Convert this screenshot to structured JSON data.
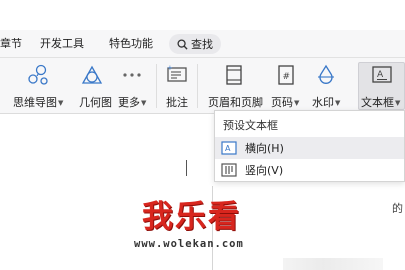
{
  "menubar": {
    "items": [
      {
        "label": "章节"
      },
      {
        "label": "开发工具"
      },
      {
        "label": "特色功能"
      }
    ],
    "search_label": "查找"
  },
  "ribbon": {
    "tools": [
      {
        "label": "思维导图",
        "icon": "mindmap-icon",
        "has_dropdown": true
      },
      {
        "label": "几何图",
        "icon": "geometry-icon",
        "has_dropdown": false
      },
      {
        "label": "更多",
        "icon": "more-dots-icon",
        "has_dropdown": true
      },
      {
        "label": "批注",
        "icon": "comment-icon",
        "has_dropdown": false
      },
      {
        "label": "页眉和页脚",
        "icon": "header-footer-icon",
        "has_dropdown": false
      },
      {
        "label": "页码",
        "icon": "page-number-icon",
        "has_dropdown": true
      },
      {
        "label": "水印",
        "icon": "watermark-icon",
        "has_dropdown": true
      },
      {
        "label": "文本框",
        "icon": "textbox-icon",
        "has_dropdown": true
      }
    ]
  },
  "dropdown": {
    "header": "预设文本框",
    "items": [
      {
        "label": "横向(H)",
        "icon": "horizontal-textbox-icon",
        "highlighted": true
      },
      {
        "label": "竖向(V)",
        "icon": "vertical-textbox-icon",
        "highlighted": false
      }
    ]
  },
  "watermark": {
    "title": "我乐看",
    "url": "www.wolekan.com"
  },
  "edge_text": "的",
  "colors": {
    "accent_red": "#d8261e",
    "ribbon_bg": "#f7f7f8",
    "highlight": "#ececef"
  }
}
